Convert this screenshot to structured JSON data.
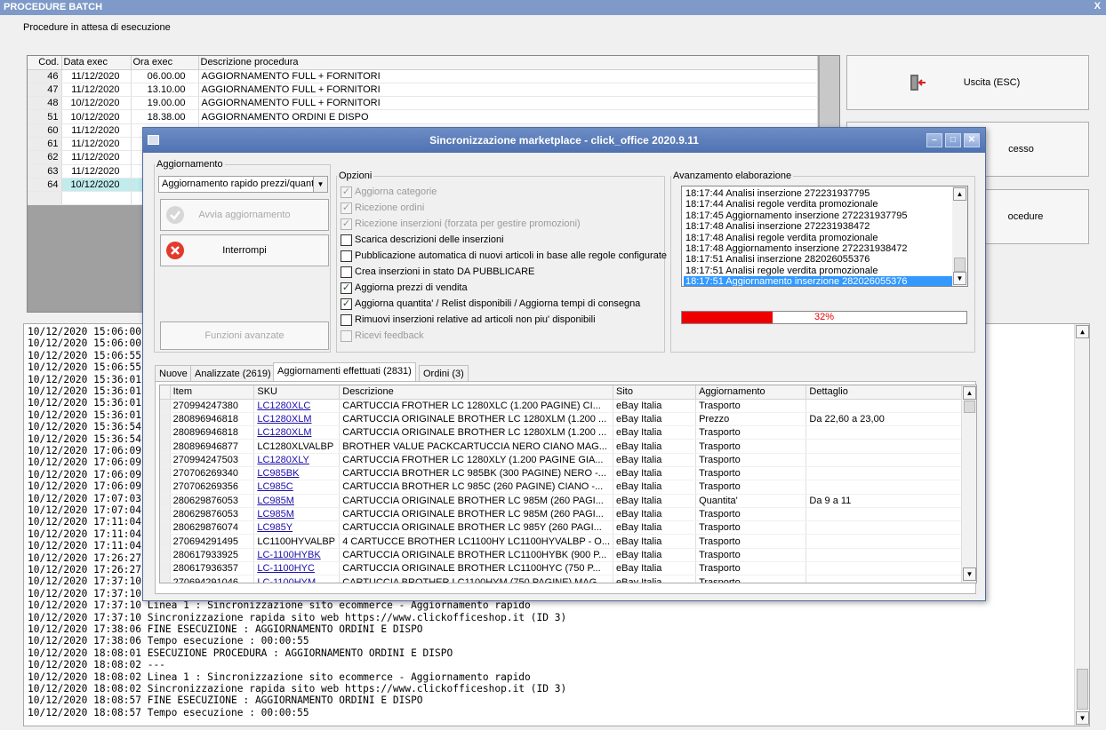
{
  "window": {
    "title": "PROCEDURE BATCH",
    "close_label": "X"
  },
  "subtitle": "Procedure in attesa di esecuzione",
  "pending": {
    "headers": [
      "Cod.",
      "Data exec",
      "Ora exec",
      "Descrizione procedura"
    ],
    "rows": [
      [
        "46",
        "11/12/2020",
        "06.00.00",
        "AGGIORNAMENTO FULL + FORNITORI"
      ],
      [
        "47",
        "11/12/2020",
        "13.10.00",
        "AGGIORNAMENTO FULL + FORNITORI"
      ],
      [
        "48",
        "10/12/2020",
        "19.00.00",
        "AGGIORNAMENTO FULL + FORNITORI"
      ],
      [
        "51",
        "10/12/2020",
        "18.38.00",
        "AGGIORNAMENTO ORDINI E DISPO"
      ],
      [
        "60",
        "11/12/2020",
        "",
        ""
      ],
      [
        "61",
        "11/12/2020",
        "",
        ""
      ],
      [
        "62",
        "11/12/2020",
        "",
        ""
      ],
      [
        "63",
        "11/12/2020",
        "",
        ""
      ],
      [
        "64",
        "10/12/2020",
        "",
        ""
      ]
    ]
  },
  "right_buttons": {
    "exit": "Uscita (ESC)",
    "process": "cesso",
    "procedures": "ocedure"
  },
  "log": [
    "10/12/2020 15:06:00 Lin",
    "10/12/2020 15:06:00 Sin",
    "10/12/2020 15:06:55 FIN",
    "10/12/2020 15:06:55 Te",
    "10/12/2020 15:36:01 ES",
    "10/12/2020 15:36:01 ---",
    "10/12/2020 15:36:01 Lin",
    "10/12/2020 15:36:01 Sin",
    "10/12/2020 15:36:54 FIN",
    "10/12/2020 15:36:54 Te",
    "10/12/2020 17:06:09 ES",
    "10/12/2020 17:06:09 ---",
    "10/12/2020 17:06:09 Lin",
    "10/12/2020 17:06:09 Sin",
    "10/12/2020 17:07:03 FIN",
    "10/12/2020 17:07:04 Te",
    "10/12/2020 17:11:04 ES",
    "10/12/2020 17:11:04 ---",
    "10/12/2020 17:11:04 Lin",
    "10/12/2020 17:26:27 FIN",
    "10/12/2020 17:26:27 Te",
    "10/12/2020 17:37:10 ES",
    "10/12/2020 17:37:10 ---",
    "10/12/2020 17:37:10 Linea 1 : Sincronizzazione sito ecommerce - Aggiornamento rapido",
    "10/12/2020 17:37:10 Sincronizzazione rapida sito web https://www.clickofficeshop.it (ID 3)",
    "10/12/2020 17:38:06 FINE ESECUZIONE : AGGIORNAMENTO ORDINI E DISPO",
    "10/12/2020 17:38:06 Tempo esecuzione : 00:00:55",
    "10/12/2020 18:08:01 ESECUZIONE PROCEDURA : AGGIORNAMENTO ORDINI E DISPO",
    "10/12/2020 18:08:02 ---",
    "10/12/2020 18:08:02 Linea 1 : Sincronizzazione sito ecommerce - Aggiornamento rapido",
    "10/12/2020 18:08:02 Sincronizzazione rapida sito web https://www.clickofficeshop.it (ID 3)",
    "10/12/2020 18:08:57 FINE ESECUZIONE : AGGIORNAMENTO ORDINI E DISPO",
    "10/12/2020 18:08:57 Tempo esecuzione : 00:00:55"
  ],
  "dialog": {
    "title": "Sincronizzazione marketplace - click_office 2020.9.11",
    "aggiornamento": {
      "legend": "Aggiornamento",
      "combo_value": "Aggiornamento rapido prezzi/quantità",
      "start_button": "Avvia aggiornamento",
      "stop_button": "Interrompi",
      "advanced_button": "Funzioni avanzate"
    },
    "opzioni": {
      "legend": "Opzioni",
      "items": [
        {
          "label": "Aggiorna categorie",
          "checked": true,
          "enabled": false
        },
        {
          "label": "Ricezione ordini",
          "checked": true,
          "enabled": false
        },
        {
          "label": "Ricezione inserzioni (forzata per gestire promozioni)",
          "checked": true,
          "enabled": false
        },
        {
          "label": "Scarica descrizioni delle inserzioni",
          "checked": false,
          "enabled": true
        },
        {
          "label": "Pubblicazione automatica di nuovi articoli in base alle regole configurate",
          "checked": false,
          "enabled": true
        },
        {
          "label": "Crea inserzioni in stato DA PUBBLICARE",
          "checked": false,
          "enabled": true
        },
        {
          "label": "Aggiorna prezzi di vendita",
          "checked": true,
          "enabled": true
        },
        {
          "label": "Aggiorna quantita' / Relist disponibili / Aggiorna tempi di consegna",
          "checked": true,
          "enabled": true
        },
        {
          "label": "Rimuovi inserzioni relative ad articoli non piu' disponibili",
          "checked": false,
          "enabled": true
        },
        {
          "label": "Ricevi feedback",
          "checked": false,
          "enabled": false
        }
      ]
    },
    "avanzamento": {
      "legend": "Avanzamento elaborazione",
      "items": [
        "18:17:44 Analisi inserzione 272231937795",
        "18:17:44 Analisi regole verdita promozionale",
        "18:17:45 Aggiornamento inserzione 272231937795",
        "18:17:48 Analisi inserzione 272231938472",
        "18:17:48 Analisi regole verdita promozionale",
        "18:17:48 Aggiornamento inserzione 272231938472",
        "18:17:51 Analisi inserzione 282026055376",
        "18:17:51 Analisi regole verdita promozionale",
        "18:17:51 Aggiornamento inserzione 282026055376"
      ],
      "selected_index": 8,
      "progress_value": 0.32,
      "progress_label": "32%"
    },
    "tabs": [
      "Nuove",
      "Analizzate (2619)",
      "Aggiornamenti effettuati (2831)",
      "Ordini (3)"
    ],
    "active_tab": 2,
    "table": {
      "headers": [
        "Item",
        "SKU",
        "Descrizione",
        "Sito",
        "Aggiornamento",
        "Dettaglio"
      ],
      "rows": [
        [
          "270994247380",
          "LC1280XLC",
          "CARTUCCIA FROTHER LC 1280XLC (1.200 PAGINE) CI...",
          "eBay Italia",
          "Trasporto",
          ""
        ],
        [
          "280896946818",
          "LC1280XLM",
          "CARTUCCIA ORIGINALE BROTHER LC 1280XLM (1.200 ...",
          "eBay Italia",
          "Prezzo",
          "Da 22,60 a 23,00"
        ],
        [
          "280896946818",
          "LC1280XLM",
          "CARTUCCIA ORIGINALE BROTHER LC 1280XLM (1.200 ...",
          "eBay Italia",
          "Trasporto",
          ""
        ],
        [
          "280896946877",
          "LC1280XLVALBP",
          "BROTHER VALUE PACKCARTUCCIA NERO CIANO MAG...",
          "eBay Italia",
          "Trasporto",
          ""
        ],
        [
          "270994247503",
          "LC1280XLY",
          "CARTUCCIA FROTHER LC 1280XLY (1.200 PAGINE GIA...",
          "eBay Italia",
          "Trasporto",
          ""
        ],
        [
          "270706269340",
          "LC985BK",
          "CARTUCCIA BROTHER LC 985BK (300 PAGINE) NERO -...",
          "eBay Italia",
          "Trasporto",
          ""
        ],
        [
          "270706269356",
          "LC985C",
          "CARTUCCIA BROTHER LC 985C (260 PAGINE) CIANO -...",
          "eBay Italia",
          "Trasporto",
          ""
        ],
        [
          "280629876053",
          "LC985M",
          "CARTUCCIA ORIGINALE BROTHER LC 985M (260 PAGI...",
          "eBay Italia",
          "Quantita'",
          "Da 9 a 11"
        ],
        [
          "280629876053",
          "LC985M",
          "CARTUCCIA ORIGINALE BROTHER LC 985M (260 PAGI...",
          "eBay Italia",
          "Trasporto",
          ""
        ],
        [
          "280629876074",
          "LC985Y",
          "CARTUCCIA ORIGINALE BROTHER LC 985Y (260 PAGI...",
          "eBay Italia",
          "Trasporto",
          ""
        ],
        [
          "270694291495",
          "LC1100HYVALBP",
          "4 CARTUCCE BROTHER LC1100HY LC1100HYVALBP - O...",
          "eBay Italia",
          "Trasporto",
          ""
        ],
        [
          "280617933925",
          "LC-1100HYBK",
          "CARTUCCIA ORIGINALE BROTHER LC1100HYBK (900 P...",
          "eBay Italia",
          "Trasporto",
          ""
        ],
        [
          "280617936357",
          "LC-1100HYC",
          "CARTUCCIA ORIGINALE BROTHER LC1100HYC (750 P...",
          "eBay Italia",
          "Trasporto",
          ""
        ],
        [
          "270694291046",
          "LC-1100HYM",
          "CARTUCCIA BROTHER LC1100HYM (750 PAGINE) MAG...",
          "eBay Italia",
          "Trasporto",
          ""
        ]
      ],
      "link_rows": [
        0,
        1,
        2,
        4,
        5,
        6,
        7,
        8,
        9,
        11,
        12,
        13
      ]
    }
  }
}
